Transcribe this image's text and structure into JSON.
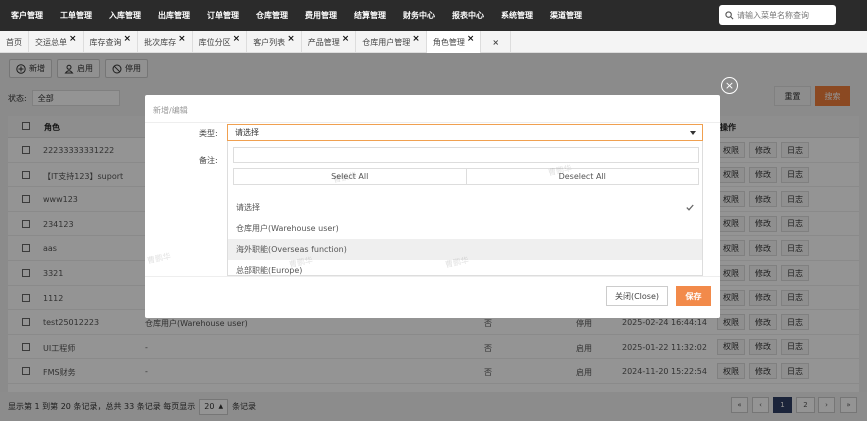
{
  "topnav": {
    "items": [
      "客户管理",
      "工单管理",
      "入库管理",
      "出库管理",
      "订单管理",
      "仓库管理",
      "费用管理",
      "结算管理",
      "财务中心",
      "报表中心",
      "系统管理",
      "渠道管理"
    ],
    "search_placeholder": "请输入菜单名称查询"
  },
  "tabs": [
    {
      "label": "首页",
      "closable": false
    },
    {
      "label": "交运总单",
      "closable": true
    },
    {
      "label": "库存查询",
      "closable": true
    },
    {
      "label": "批次库存",
      "closable": true
    },
    {
      "label": "库位分区",
      "closable": true
    },
    {
      "label": "客户列表",
      "closable": true
    },
    {
      "label": "产品管理",
      "closable": true
    },
    {
      "label": "仓库用户管理",
      "closable": true
    },
    {
      "label": "角色管理",
      "closable": true,
      "active": true
    }
  ],
  "tab_close_all": "×",
  "toolbar": {
    "add": "新增",
    "enable": "启用",
    "disable": "停用"
  },
  "filter": {
    "status_label": "状态:",
    "status_value": "全部",
    "reset": "重置",
    "search": "搜索"
  },
  "grid": {
    "columns": {
      "role": "角色",
      "ops": "操作"
    },
    "rows": [
      {
        "name": "22233333331222",
        "type": "",
        "flag": "",
        "status": "",
        "time": ""
      },
      {
        "name": "【IT支持123】suport",
        "type": "",
        "flag": "",
        "status": "",
        "time": ""
      },
      {
        "name": "www123",
        "type": "",
        "flag": "",
        "status": "",
        "time": ""
      },
      {
        "name": "234123",
        "type": "",
        "flag": "",
        "status": "",
        "time": ""
      },
      {
        "name": "aas",
        "type": "",
        "flag": "",
        "status": "",
        "time": ""
      },
      {
        "name": "3321",
        "type": "",
        "flag": "",
        "status": "",
        "time": ""
      },
      {
        "name": "1112",
        "type": "",
        "flag": "",
        "status": "",
        "time": ""
      },
      {
        "name": "test25012223",
        "type": "仓库用户(Warehouse user)",
        "flag": "否",
        "status": "停用",
        "time": "2025-02-24 16:44:14"
      },
      {
        "name": "UI工程师",
        "type": "-",
        "flag": "否",
        "status": "启用",
        "time": "2025-01-22 11:32:02"
      },
      {
        "name": "FMS财务",
        "type": "-",
        "flag": "否",
        "status": "启用",
        "time": "2024-11-20 15:22:54"
      }
    ],
    "actions": {
      "perm": "权限",
      "edit": "修改",
      "log": "日志"
    }
  },
  "modal": {
    "title": "新增/编辑",
    "type_label": "类型:",
    "remark_label": "备注:",
    "select_value": "请选择",
    "select_all": "Select All",
    "deselect_all": "Deselect All",
    "options": [
      {
        "label": "请选择",
        "checked": true
      },
      {
        "label": "仓库用户(Warehouse user)",
        "checked": false
      },
      {
        "label": "海外职能(Overseas function)",
        "checked": false,
        "highlight": true
      },
      {
        "label": "总部职能(Europe)",
        "checked": false
      }
    ],
    "close": "关闭(Close)",
    "save": "保存",
    "watermark": "曹鹏华"
  },
  "footer": {
    "text_before": "显示第 1 到第 20 条记录，总共 33 条记录 每页显示",
    "page_size": "20",
    "text_after": "条记录",
    "pages": [
      "«",
      "‹",
      "1",
      "2",
      "›",
      "»"
    ],
    "current_page": "1"
  }
}
